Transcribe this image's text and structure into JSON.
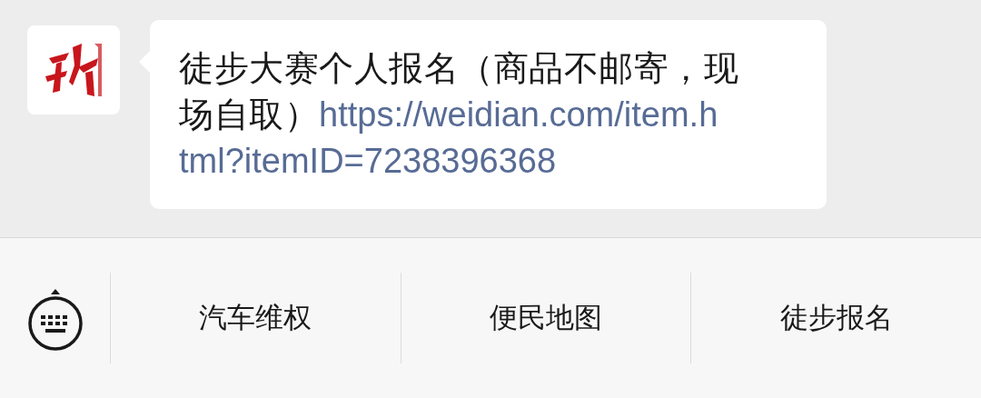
{
  "message": {
    "text": "徒步大赛个人报名（商品不邮寄，现场自取）",
    "link_lines": [
      "https://weidian.com/item.h",
      "tml?itemID=7238396368"
    ]
  },
  "menu": [
    {
      "label": "汽车维权"
    },
    {
      "label": "便民地图"
    },
    {
      "label": "徒步报名"
    }
  ]
}
